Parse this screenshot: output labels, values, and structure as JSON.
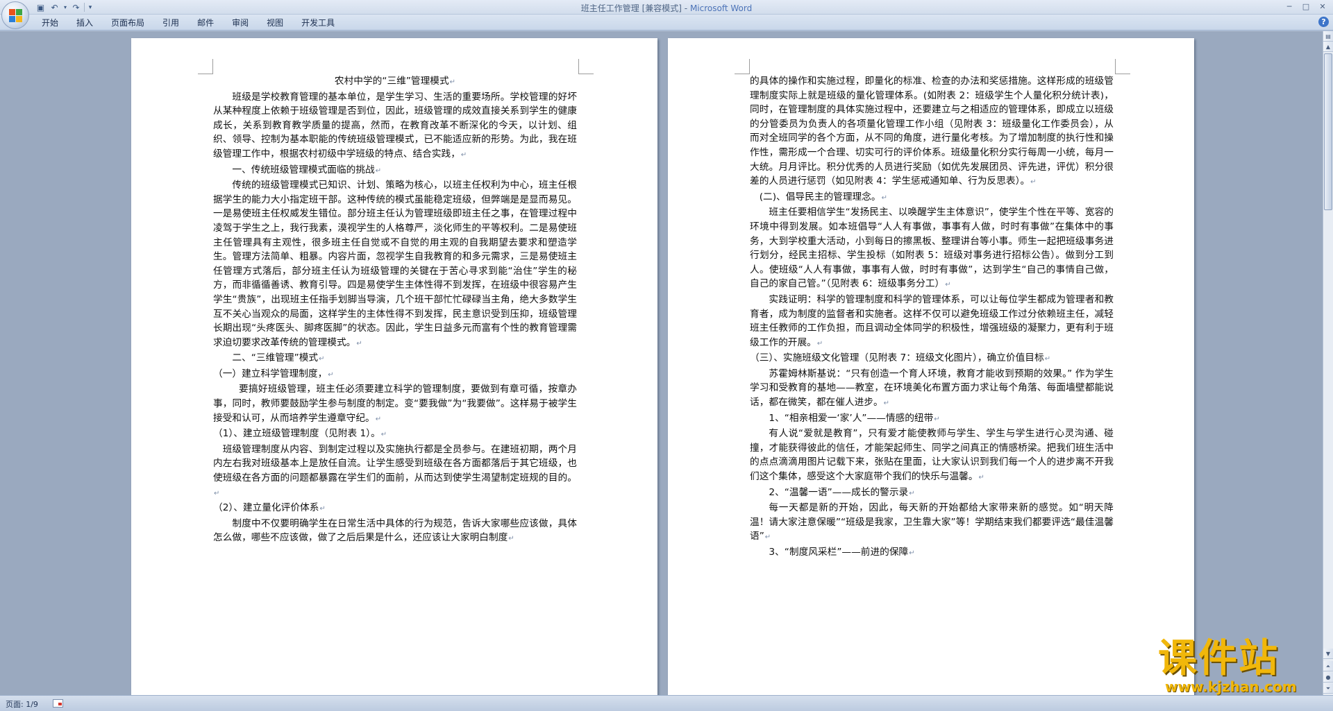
{
  "window": {
    "title_doc": "班主任工作管理 [兼容模式]",
    "title_sep": " - ",
    "title_app": "Microsoft Word"
  },
  "ribbon": {
    "tabs": [
      "开始",
      "插入",
      "页面布局",
      "引用",
      "邮件",
      "审阅",
      "视图",
      "开发工具"
    ]
  },
  "page_left": {
    "paragraphs": [
      {
        "text": "农村中学的“三维”管理模式",
        "style": "center"
      },
      {
        "text": "班级是学校教育管理的基本单位，是学生学习、生活的重要场所。学校管理的好坏从某种程度上依赖于班级管理是否到位，因此，班级管理的成效直接关系到学生的健康成长，关系到教育教学质量的提高，然而，在教育改革不断深化的今天，以计划、组织、领导、控制为基本职能的传统班级管理模式，已不能适应新的形势。为此，我在班级管理工作中，根据农村初级中学班级的特点、结合实践，",
        "style": "ind2"
      },
      {
        "text": "一、传统班级管理模式面临的挑战",
        "style": "ind2"
      },
      {
        "text": "传统的班级管理模式已知识、计划、策略为核心，以班主任权利为中心，班主任根据学生的能力大小指定班干部。这种传统的模式虽能稳定班级，但弊端是是显而易见。一是易使班主任权威发生错位。部分班主任认为管理班级即班主任之事，在管理过程中凌驾于学生之上，我行我素，漠视学生的人格尊严，淡化师生的平等权利。二是易使班主任管理具有主观性，很多班主任自觉或不自觉的用主观的自我期望去要求和塑造学生。管理方法简单、粗暴。内容片面，忽视学生自我教育的和多元需求，三是易使班主任管理方式落后，部分班主任认为班级管理的关键在于苦心寻求到能“治住”学生的秘方，而非循循善诱、教育引导。四是易使学生主体性得不到发挥，在班级中很容易产生学生“贵族”，出现班主任指手划脚当导演，几个班干部忙忙碌碌当主角，绝大多数学生互不关心当观众的局面，这样学生的主体性得不到发挥，民主意识受到压抑，班级管理长期出现“头疼医头、脚疼医脚”的状态。因此，学生日益多元而富有个性的教育管理需求迫切要求改革传统的管理模式。",
        "style": "ind2"
      },
      {
        "text": "二、“三维管理”模式",
        "style": "ind2"
      },
      {
        "text": "（一）建立科学管理制度，",
        "style": "none"
      },
      {
        "text": "要搞好班级管理，班主任必须要建立科学的管理制度，要做到有章可循，按章办事，同时，教师要鼓励学生参与制度的制定。变“要我做”为“我要做”。这样易于被学生接受和认可，从而培养学生遵章守纪。",
        "style": "ind3"
      },
      {
        "text": "（1）、建立班级管理制度（见附表 1）。",
        "style": "none"
      },
      {
        "text": "班级管理制度从内容、到制定过程以及实施执行都是全员参与。在建班初期，两个月内左右我对班级基本上是放任自流。让学生感受到班级在各方面都落后于其它班级，也使班级在各方面的问题都暴露在学生们的面前，从而达到使学生渴望制定班规的目的。",
        "style": "ind1"
      },
      {
        "text": "（2）、建立量化评价体系",
        "style": "none"
      },
      {
        "text": "制度中不仅要明确学生在日常生活中具体的行为规范，告诉大家哪些应该做，具体怎么做，哪些不应该做，做了之后后果是什么，还应该让大家明白制度",
        "style": "ind2"
      }
    ]
  },
  "page_right": {
    "paragraphs": [
      {
        "text": "的具体的操作和实施过程，即量化的标准、检查的办法和奖惩措施。这样形成的班级管理制度实际上就是班级的量化管理体系。(如附表 2：班级学生个人量化积分统计表)，同时，在管理制度的具体实施过程中，还要建立与之相适应的管理体系，即成立以班级的分管委员为负责人的各项量化管理工作小组（见附表 3：班级量化工作委员会），从而对全班同学的各个方面，从不同的角度，进行量化考核。为了增加制度的执行性和操作性，需形成一个合理、切实可行的评价体系。班级量化积分实行每周一小统，每月一大统。月月评比。积分优秀的人员进行奖励（如优先发展团员、评先进，评优）积分很差的人员进行惩罚（如见附表 4：学生惩戒通知单、行为反思表）。",
        "style": "none"
      },
      {
        "text": "(二)、倡导民主的管理理念。",
        "style": "ind1"
      },
      {
        "text": "班主任要相信学生“发扬民主、以唤醒学生主体意识”，使学生个性在平等、宽容的环境中得到发展。如本班倡导“人人有事做，事事有人做，时时有事做”在集体中的事务，大到学校重大活动，小到每日的擦黑板、整理讲台等小事。师生一起把班级事务进行划分，经民主招标、学生投标（如附表 5：班级对事务进行招标公告）。做到分工到人。使班级“人人有事做，事事有人做，时时有事做”，达到学生“自己的事情自己做，自己的家自己管。”（见附表 6：班级事务分工）",
        "style": "ind2"
      },
      {
        "text": "实践证明：科学的管理制度和科学的管理体系，可以让每位学生都成为管理者和教育者，成为制度的监督者和实施者。这样不仅可以避免班级工作过分依赖班主任，减轻班主任教师的工作负担，而且调动全体同学的积极性，增强班级的凝聚力，更有利于班级工作的开展。",
        "style": "ind2"
      },
      {
        "text": "（三）、实施班级文化管理（见附表 7：班级文化图片），确立价值目标",
        "style": "none"
      },
      {
        "text": "苏霍姆林斯基说：“只有创造一个育人环境，教育才能收到预期的效果。” 作为学生学习和受教育的基地——教室，在环境美化布置方面力求让每个角落、每面墙壁都能说话，都在微笑，都在催人进步。",
        "style": "ind2"
      },
      {
        "text": "1、“相亲相爱一‘家’人”——情感的纽带",
        "style": "ind2"
      },
      {
        "text": "有人说“爱就是教育”，只有爱才能使教师与学生、学生与学生进行心灵沟通、碰撞，才能获得彼此的信任，才能架起师生、同学之间真正的情感桥梁。把我们班生活中的点点滴滴用图片记载下来，张贴在里面，让大家认识到我们每一个人的进步离不开我们这个集体，感受这个大家庭带个我们的快乐与温馨。",
        "style": "ind2"
      },
      {
        "text": "2、“温馨一语”——成长的警示录",
        "style": "ind2"
      },
      {
        "text": "每一天都是新的开始，因此，每天新的开始都给大家带来新的感觉。如“明天降温！请大家注意保暖”“班级是我家，卫生靠大家”等！学期结束我们都要评选“最佳温馨语”",
        "style": "ind2"
      },
      {
        "text": "3、“制度风采栏”——前进的保障",
        "style": "ind2"
      }
    ]
  },
  "statusbar": {
    "page_info": "页面: 1/9"
  },
  "watermark": {
    "main": "课件站",
    "url": "www.kjzhan.com"
  },
  "icons": {
    "office": "office-button-icon",
    "save": "save-icon",
    "undo": "undo-icon",
    "redo": "redo-icon",
    "customize": "qat-dropdown-icon",
    "help": "help-icon"
  }
}
